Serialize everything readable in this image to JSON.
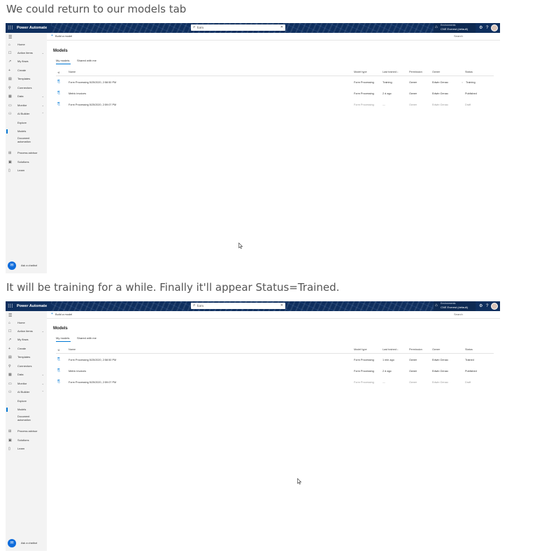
{
  "caption1": "We could return to our models tab",
  "caption2": "It will be training for a while. Finally it'll appear Status=Trained.",
  "shots": [
    {
      "app_title": "Power Automate",
      "search_value": "form",
      "env_label": "Environments",
      "env_name": "CNE Everest (default)",
      "build_model": "Build a model",
      "cmd_search": "Search",
      "nav": [
        "Home",
        "Action items",
        "My flows",
        "Create",
        "Templates",
        "Connectors",
        "Data",
        "Monitor",
        "AI Builder",
        "Explore",
        "Models",
        "Document automation",
        "Process advisor",
        "Solutions",
        "Learn"
      ],
      "ask_label": "Ask a chatbot",
      "heading": "Models",
      "tabs": [
        "My models",
        "Shared with me"
      ],
      "columns": [
        "Name",
        "Model type",
        "Last trained ↓",
        "Permission",
        "Owner",
        "Status"
      ],
      "rows": [
        {
          "name": "Form Processing 5/25/2020, 2:58:50 PM",
          "type": "Form Processing",
          "trained": "Training",
          "perm": "Owner",
          "owner": "Edwin Genao",
          "status": "Training"
        },
        {
          "name": "Metric invoices",
          "type": "Form Processing",
          "trained": "2 d ago",
          "perm": "Owner",
          "owner": "Edwin Genao",
          "status": "Published"
        },
        {
          "name": "Form Processing 5/25/2020, 2:59:07 PM",
          "type": "Form Processing",
          "trained": "—",
          "perm": "Owner",
          "owner": "Edwin Genao",
          "status": "Draft"
        }
      ]
    },
    {
      "app_title": "Power Automate",
      "search_value": "form",
      "env_label": "Environments",
      "env_name": "CNE Everest (default)",
      "build_model": "Build a model",
      "cmd_search": "Search",
      "nav": [
        "Home",
        "Action items",
        "My flows",
        "Create",
        "Templates",
        "Connectors",
        "Data",
        "Monitor",
        "AI Builder",
        "Explore",
        "Models",
        "Document automation",
        "Process advisor",
        "Solutions",
        "Learn"
      ],
      "ask_label": "Ask a chatbot",
      "heading": "Models",
      "tabs": [
        "My models",
        "Shared with me"
      ],
      "columns": [
        "Name",
        "Model type",
        "Last trained ↓",
        "Permission",
        "Owner",
        "Status"
      ],
      "rows": [
        {
          "name": "Form Processing 5/25/2020, 2:58:50 PM",
          "type": "Form Processing",
          "trained": "1 min ago",
          "perm": "Owner",
          "owner": "Edwin Genao",
          "status": "Trained"
        },
        {
          "name": "Metric invoices",
          "type": "Form Processing",
          "trained": "2 d ago",
          "perm": "Owner",
          "owner": "Edwin Genao",
          "status": "Published"
        },
        {
          "name": "Form Processing 5/25/2020, 2:59:07 PM",
          "type": "Form Processing",
          "trained": "—",
          "perm": "Owner",
          "owner": "Edwin Genao",
          "status": "Draft"
        }
      ]
    }
  ]
}
